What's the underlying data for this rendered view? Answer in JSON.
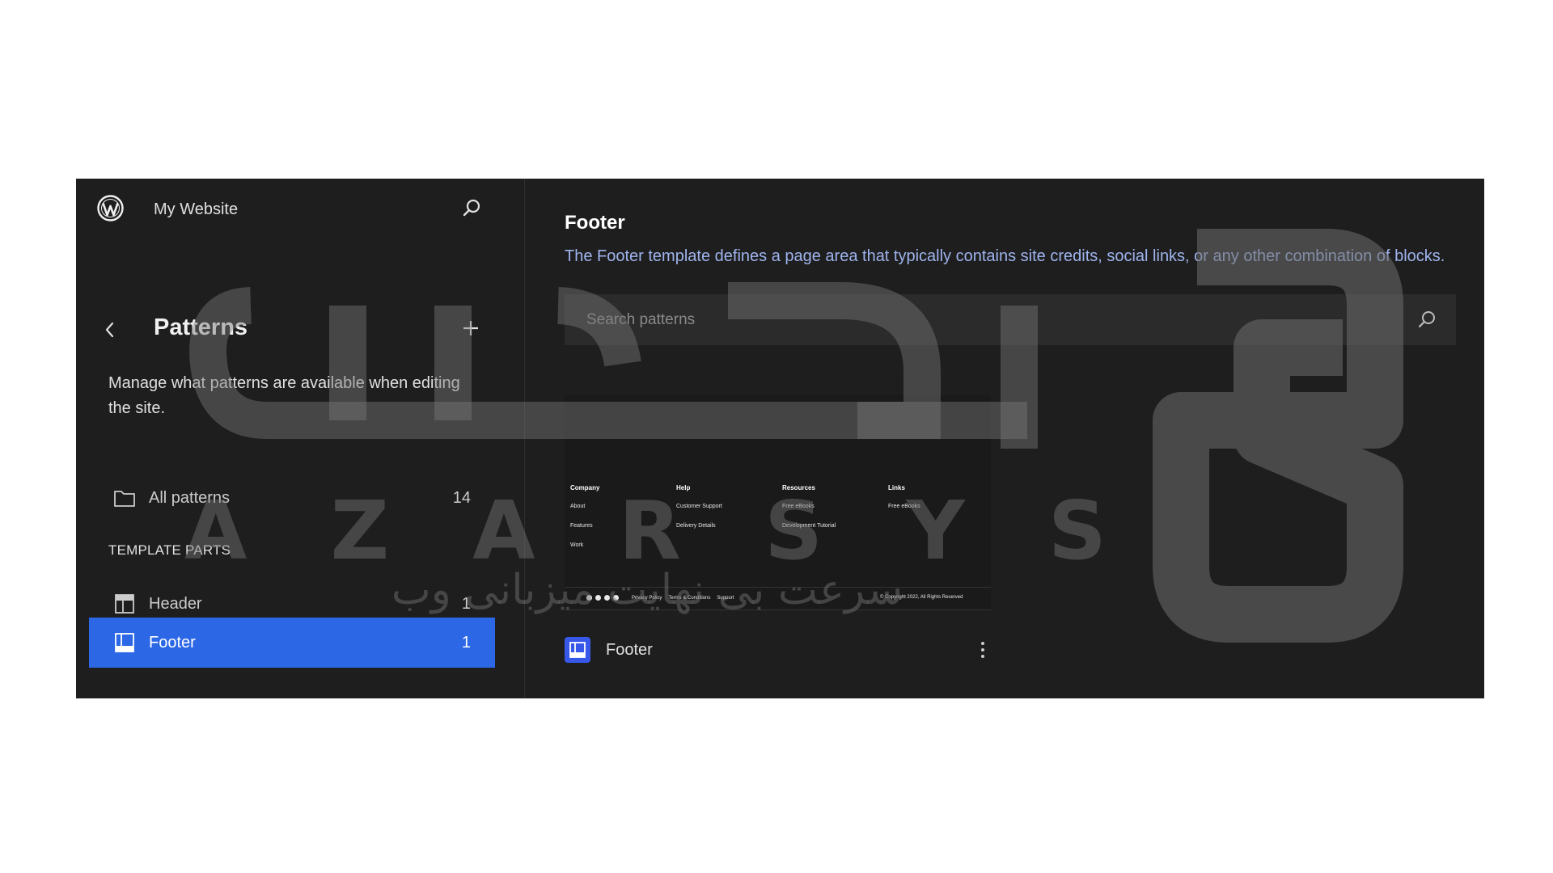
{
  "header": {
    "site_title": "My Website"
  },
  "nav": {
    "title": "Patterns",
    "description": "Manage what patterns are available when editing the site.",
    "all_patterns": {
      "label": "All patterns",
      "count": "14"
    },
    "section_heading": "TEMPLATE PARTS",
    "items": [
      {
        "label": "Header",
        "count": "1"
      },
      {
        "label": "Footer",
        "count": "1",
        "active": true
      }
    ]
  },
  "content": {
    "title": "Footer",
    "description": "The Footer template defines a page area that typically contains site credits, social links, or any other combination of blocks.",
    "search_placeholder": "Search patterns",
    "card": {
      "title": "Footer",
      "preview": {
        "columns": [
          {
            "heading": "Company",
            "links": [
              "About",
              "Features",
              "Work"
            ]
          },
          {
            "heading": "Help",
            "links": [
              "Customer Support",
              "Delivery Details"
            ]
          },
          {
            "heading": "Resources",
            "links": [
              "Free eBooks",
              "Development Tutorial"
            ]
          },
          {
            "heading": "Links",
            "links": [
              "Free eBooks"
            ]
          }
        ],
        "bottom_links": [
          "Privacy Policy",
          "Terms & Conditions",
          "Support"
        ],
        "copyright": "© Copyright 2022, All Rights Reserved"
      }
    }
  },
  "watermark": {
    "letters": [
      "A",
      "Z",
      "A",
      "R",
      "S",
      "Y",
      "S"
    ],
    "tagline": "سرعت بی نهایت میزبانی وب"
  },
  "colors": {
    "background": "#1e1e1e",
    "accent": "#2c67e6",
    "description_text": "#9fb4ee"
  },
  "icons": [
    "wordpress-logo-icon",
    "search-icon",
    "chevron-left-icon",
    "plus-icon",
    "folder-icon",
    "header-template-icon",
    "footer-template-icon",
    "more-vertical-icon"
  ]
}
